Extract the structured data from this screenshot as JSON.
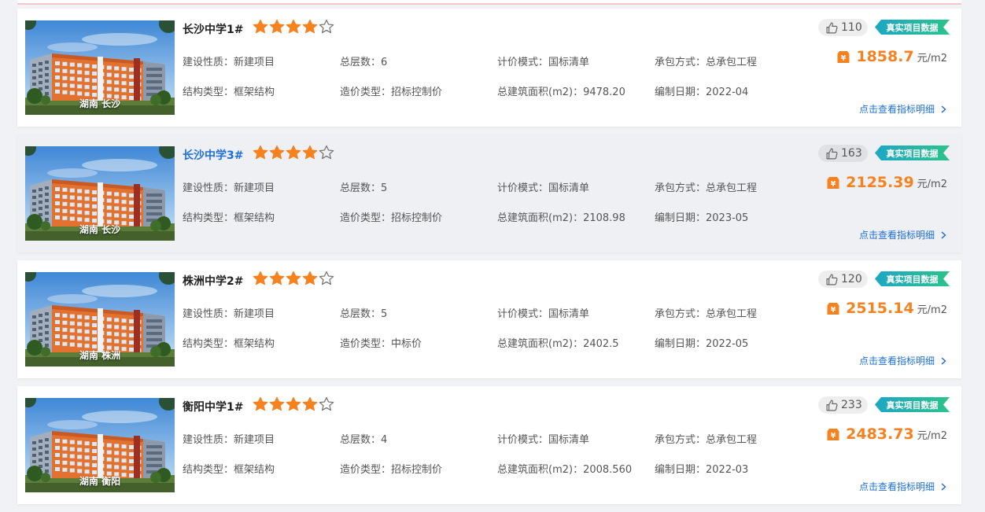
{
  "labels": {
    "nature": "建设性质：",
    "floors": "总层数：",
    "pricing": "计价模式：",
    "contract": "承包方式：",
    "structure": "结构类型：",
    "cost_type": "造价类型：",
    "area": "总建筑面积(m2)：",
    "date": "编制日期：",
    "badge": "真实项目数据",
    "unit": "元/m2",
    "detail_link": "点击查看指标明细"
  },
  "colors": {
    "accent_orange": "#f5821f",
    "link_blue": "#1e6fd9",
    "badge_start": "#1ea7c5",
    "badge_end": "#2cc28b"
  },
  "projects": [
    {
      "title": "长沙中学1#",
      "rating": 4,
      "rating_max": 5,
      "location": "湖南 长沙",
      "nature": "新建项目",
      "floors": "6",
      "pricing": "国标清单",
      "contract": "总承包工程",
      "structure": "框架结构",
      "cost_type": "招标控制价",
      "area": "9478.20",
      "date": "2022-04",
      "likes": "110",
      "price": "1858.7"
    },
    {
      "title": "长沙中学3#",
      "rating": 4,
      "rating_max": 5,
      "location": "湖南 长沙",
      "nature": "新建项目",
      "floors": "5",
      "pricing": "国标清单",
      "contract": "总承包工程",
      "structure": "框架结构",
      "cost_type": "招标控制价",
      "area": "2108.98",
      "date": "2023-05",
      "likes": "163",
      "price": "2125.39"
    },
    {
      "title": "株洲中学2#",
      "rating": 4,
      "rating_max": 5,
      "location": "湖南 株洲",
      "nature": "新建项目",
      "floors": "5",
      "pricing": "国标清单",
      "contract": "总承包工程",
      "structure": "框架结构",
      "cost_type": "中标价",
      "area": "2402.5",
      "date": "2022-05",
      "likes": "120",
      "price": "2515.14"
    },
    {
      "title": "衡阳中学1#",
      "rating": 4,
      "rating_max": 5,
      "location": "湖南 衡阳",
      "nature": "新建项目",
      "floors": "4",
      "pricing": "国标清单",
      "contract": "总承包工程",
      "structure": "框架结构",
      "cost_type": "招标控制价",
      "area": "2008.560",
      "date": "2022-03",
      "likes": "233",
      "price": "2483.73"
    }
  ]
}
